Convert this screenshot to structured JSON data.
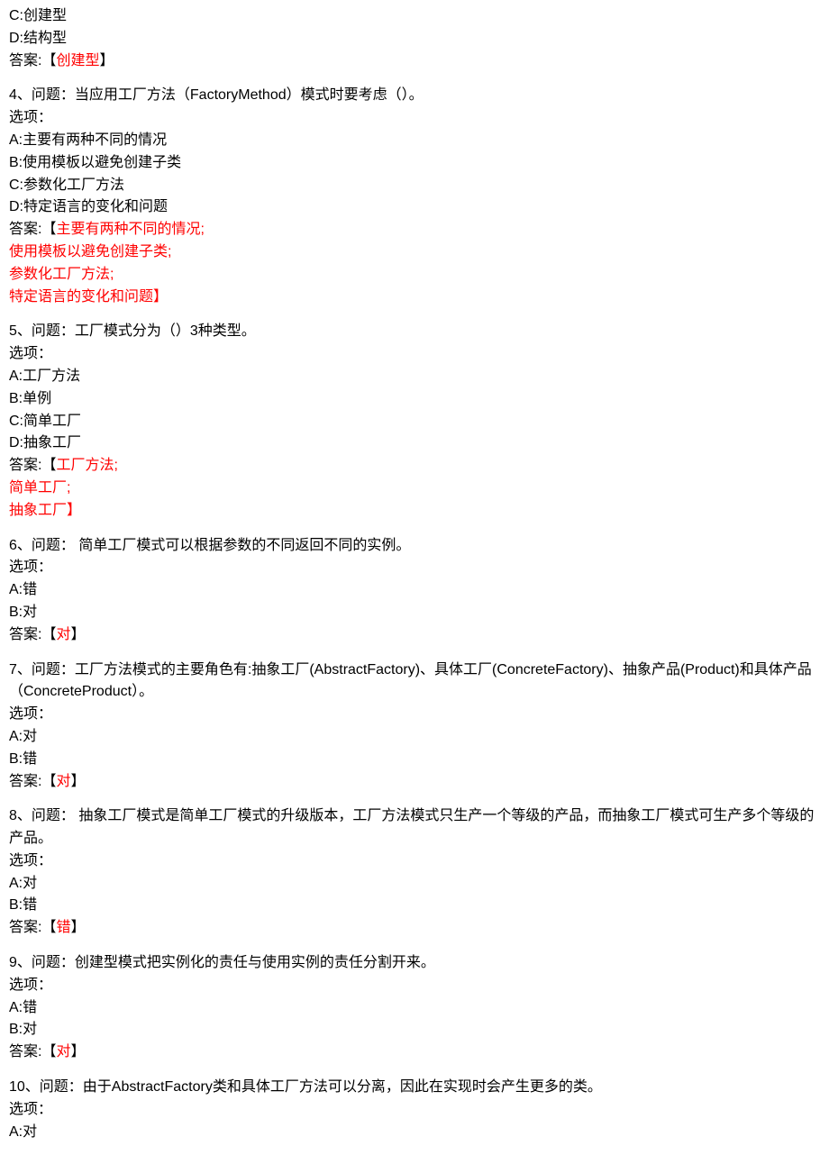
{
  "top_fragment": {
    "optC": "C:创建型",
    "optD": "D:结构型",
    "ans_prefix": "答案:【",
    "ans_text": "创建型",
    "ans_suffix": "】"
  },
  "q4": {
    "question": "4、问题：当应用工厂方法（FactoryMethod）模式时要考虑（）。",
    "opt_label": "选项：",
    "optA": "A:主要有两种不同的情况",
    "optB": "B:使用模板以避免创建子类",
    "optC": "C:参数化工厂方法",
    "optD": "D:特定语言的变化和问题",
    "ans_prefix": "答案:【",
    "ans_l1": "主要有两种不同的情况;",
    "ans_l2": "使用模板以避免创建子类;",
    "ans_l3": "参数化工厂方法;",
    "ans_l4": "特定语言的变化和问题】"
  },
  "q5": {
    "question": "5、问题：工厂模式分为（）3种类型。",
    "opt_label": "选项：",
    "optA": "A:工厂方法",
    "optB": "B:单例",
    "optC": "C:简单工厂",
    "optD": "D:抽象工厂",
    "ans_prefix": "答案:【",
    "ans_l1": "工厂方法;",
    "ans_l2": "简单工厂;",
    "ans_l3": "抽象工厂】"
  },
  "q6": {
    "question": "6、问题： 简单工厂模式可以根据参数的不同返回不同的实例。",
    "opt_label": "选项：",
    "optA": "A:错",
    "optB": "B:对",
    "ans_prefix": "答案:【",
    "ans_text": "对",
    "ans_suffix": "】"
  },
  "q7": {
    "question": "7、问题：工厂方法模式的主要角色有:抽象工厂(AbstractFactory)、具体工厂(ConcreteFactory)、抽象产品(Product)和具体产品（ConcreteProduct）。",
    "opt_label": "选项：",
    "optA": "A:对",
    "optB": "B:错",
    "ans_prefix": "答案:【",
    "ans_text": "对",
    "ans_suffix": "】"
  },
  "q8": {
    "question": "8、问题： 抽象工厂模式是简单工厂模式的升级版本，工厂方法模式只生产一个等级的产品，而抽象工厂模式可生产多个等级的产品。",
    "opt_label": "选项：",
    "optA": "A:对",
    "optB": "B:错",
    "ans_prefix": "答案:【",
    "ans_text": "错",
    "ans_suffix": "】"
  },
  "q9": {
    "question": "9、问题：创建型模式把实例化的责任与使用实例的责任分割开来。",
    "opt_label": "选项：",
    "optA": "A:错",
    "optB": "B:对",
    "ans_prefix": "答案:【",
    "ans_text": "对",
    "ans_suffix": "】"
  },
  "q10": {
    "question": "10、问题：由于AbstractFactory类和具体工厂方法可以分离，因此在实现时会产生更多的类。",
    "opt_label": "选项：",
    "optA": "A:对"
  }
}
